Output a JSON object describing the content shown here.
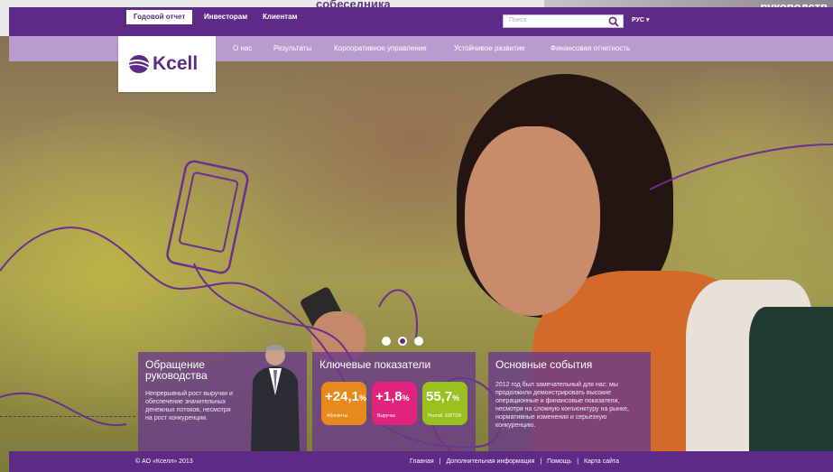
{
  "background_strip": {
    "title": "собеседника",
    "right_text": "руководств"
  },
  "top_tabs": [
    {
      "label": "Годовой отчет",
      "active": true
    },
    {
      "label": "Инвесторам",
      "active": false
    },
    {
      "label": "Клиентам",
      "active": false
    }
  ],
  "search": {
    "placeholder": "Поиск",
    "icon": "search-icon"
  },
  "language": {
    "label": "РУС",
    "icon": "chevron-down-icon"
  },
  "nav": [
    {
      "label": "О нас"
    },
    {
      "label": "Результаты"
    },
    {
      "label": "Корпоративное управление"
    },
    {
      "label": "Устойчивое развитие"
    },
    {
      "label": "Финансовая отчетность"
    }
  ],
  "logo": {
    "text": "Kcell",
    "icon": "kcell-logo-icon"
  },
  "carousel": {
    "dots": 3,
    "active": 2
  },
  "cards": {
    "management": {
      "title": "Обращение руководства",
      "text": "Непрерывный рост выручки и обеспечение значительных денежных потоков, несмотря на рост конкуренции."
    },
    "indicators": {
      "title": "Ключевые показатели",
      "items": [
        {
          "sign": "+",
          "value": "24,1",
          "unit": "%",
          "caption": "Абоненты",
          "color": "#e8891d"
        },
        {
          "sign": "+",
          "value": "1,8",
          "unit": "%",
          "caption": "Выручка",
          "color": "#e0237d"
        },
        {
          "sign": "",
          "value": "55,7",
          "unit": "%",
          "caption": "Рентаб. EBITDA",
          "color": "#99c21f"
        }
      ]
    },
    "events": {
      "title": "Основные события",
      "text": "2012 год был замечательный для нас: мы продолжили демонстрировать высокие операционные и финансовые показатели, несмотря на сложную конъюнктуру на рынке, нормативные изменения и серьезную конкуренцию."
    }
  },
  "footer": {
    "copyright": "© АО «Кселл» 2013",
    "links": [
      "Главная",
      "Дополнительная информация",
      "Помощь",
      "Карта сайта"
    ],
    "separator": "|"
  },
  "colors": {
    "brand_purple": "#5d2a86",
    "nav_lilac": "#b99ccf"
  }
}
